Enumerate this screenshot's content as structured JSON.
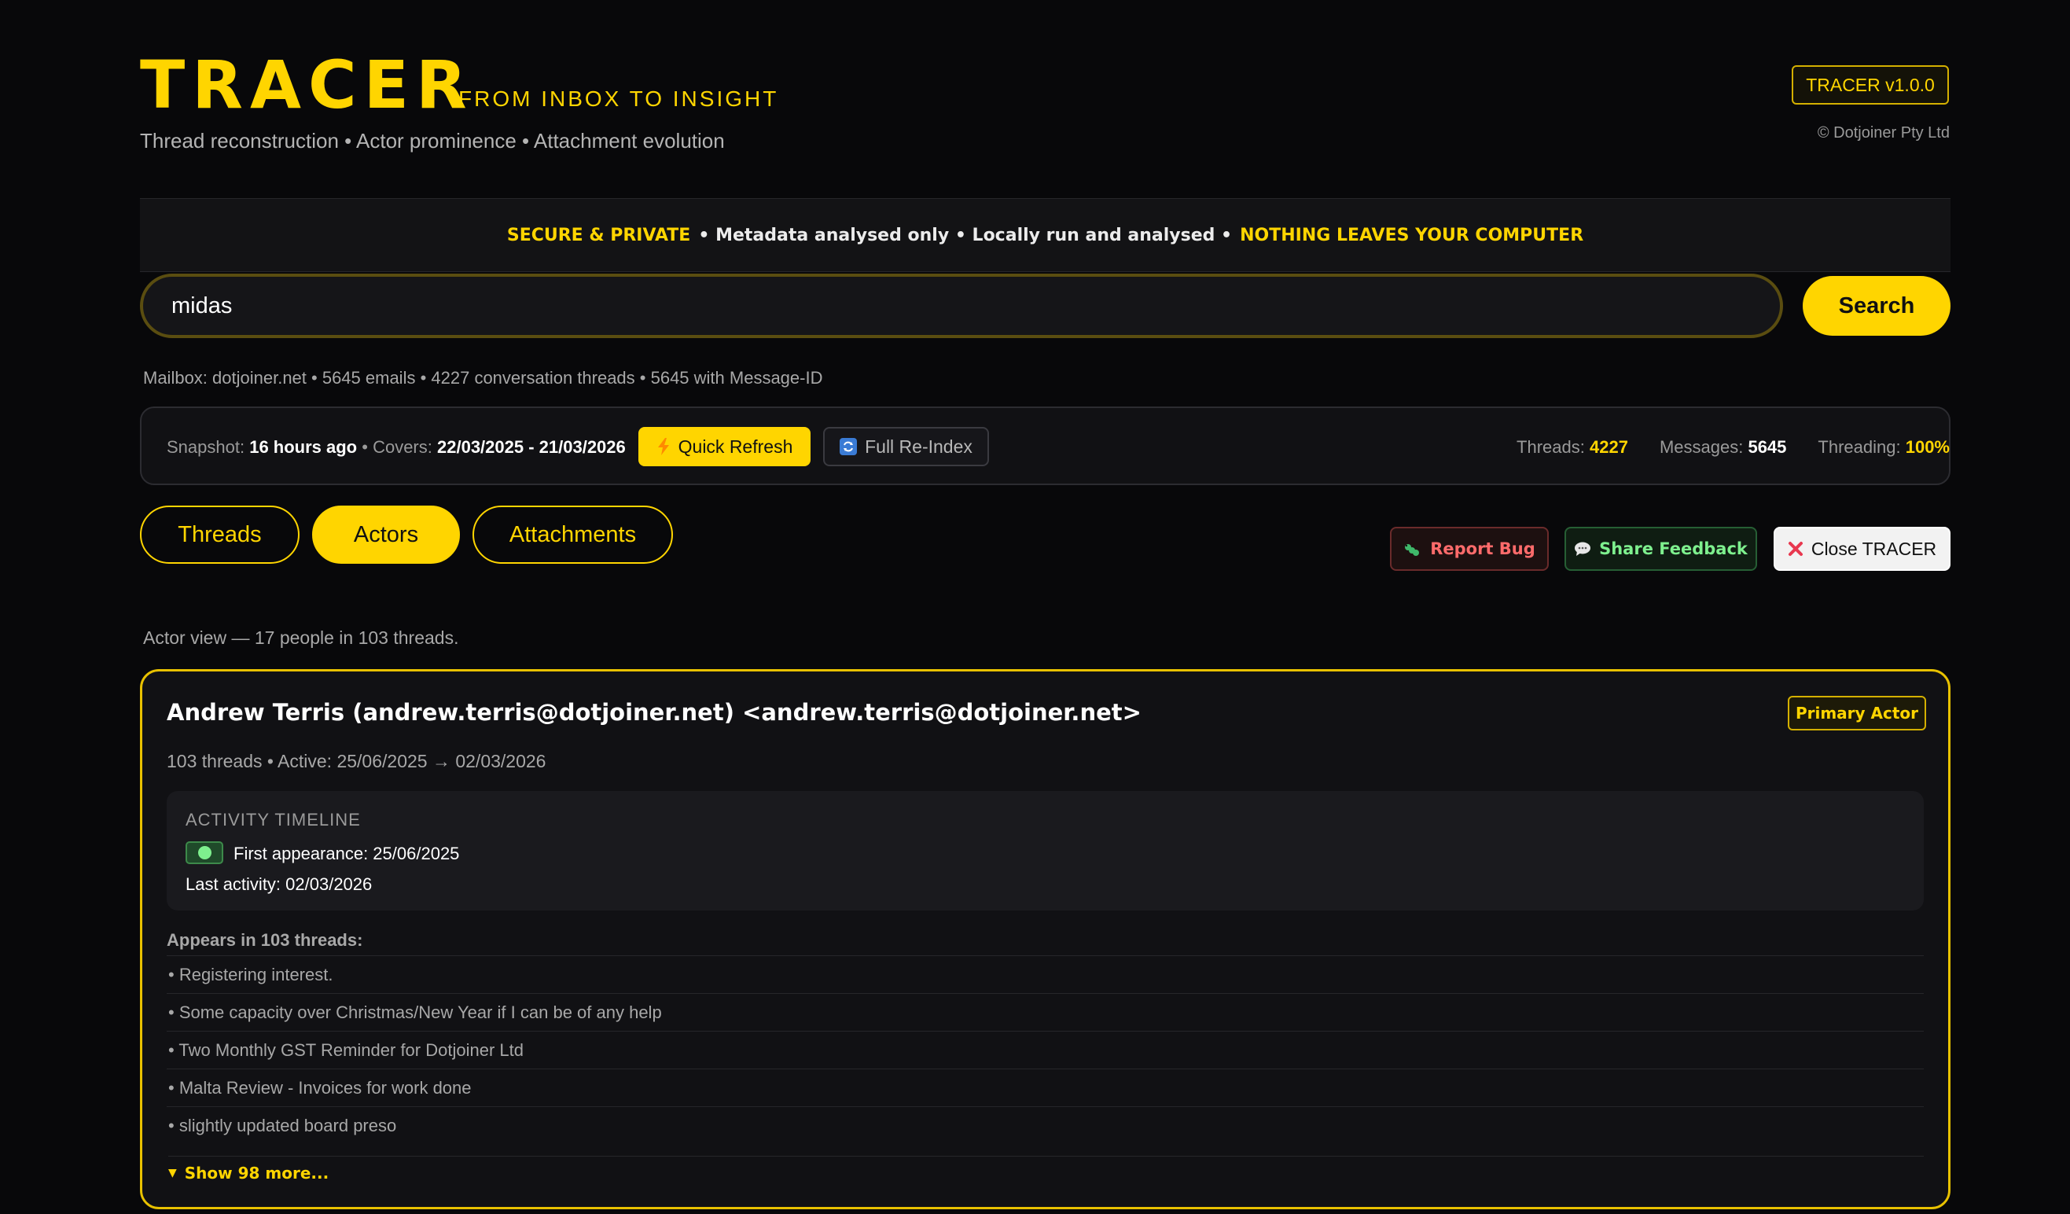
{
  "header": {
    "logo": "TRACER",
    "tagline": "FROM INBOX TO INSIGHT",
    "subtitle": "Thread reconstruction • Actor prominence • Attachment evolution",
    "version": "TRACER v1.0.0",
    "copyright": "© Dotjoiner Pty Ltd"
  },
  "banner": {
    "part1": "SECURE & PRIVATE",
    "part2": "• Metadata analysed only • Locally run and analysed •",
    "part3": "NOTHING LEAVES YOUR COMPUTER"
  },
  "search": {
    "value": "midas",
    "button": "Search"
  },
  "mailbox_info": "Mailbox: dotjoiner.net • 5645 emails • 4227 conversation threads • 5645 with Message-ID",
  "snapshot": {
    "label": "Snapshot:",
    "age": "16 hours ago",
    "covers_label": "• Covers:",
    "range": "22/03/2025 - 21/03/2026",
    "quick_refresh": "Quick Refresh",
    "full_reindex": "Full Re-Index",
    "threads_label": "Threads:",
    "threads_value": "4227",
    "messages_label": "Messages:",
    "messages_value": "5645",
    "threading_label": "Threading:",
    "threading_value": "100%"
  },
  "tabs": [
    {
      "label": "Threads",
      "active": false
    },
    {
      "label": "Actors",
      "active": true
    },
    {
      "label": "Attachments",
      "active": false
    }
  ],
  "actions": {
    "report_bug": "Report Bug",
    "share_feedback": "Share Feedback",
    "close": "Close TRACER"
  },
  "actor_view_summary": "Actor view — 17 people in 103 threads.",
  "actor": {
    "name": "Andrew Terris (andrew.terris@dotjoiner.net) <andrew.terris@dotjoiner.net>",
    "badge": "Primary Actor",
    "meta": "103 threads • Active: 25/06/2025 → 02/03/2026",
    "timeline_title": "ACTIVITY TIMELINE",
    "first_appearance": "First appearance: 25/06/2025",
    "last_activity": "Last activity: 02/03/2026",
    "appears_label": "Appears in 103 threads:",
    "threads": [
      "• Registering interest.",
      "• Some capacity over Christmas/New Year if I can be of any help",
      "• Two Monthly GST Reminder for Dotjoiner Ltd",
      "• Malta Review - Invoices for work done",
      "• slightly updated board preso"
    ],
    "show_more": "Show 98 more..."
  },
  "colors": {
    "accent": "#ffd500",
    "background": "#08080a",
    "danger": "#ff6b6b",
    "success": "#7ef08e"
  },
  "icons": {
    "quick_refresh": "lightning-icon",
    "full_reindex": "refresh-icon",
    "report_bug": "bug-icon",
    "share_feedback": "speech-bubble-icon",
    "close": "close-x-icon"
  }
}
